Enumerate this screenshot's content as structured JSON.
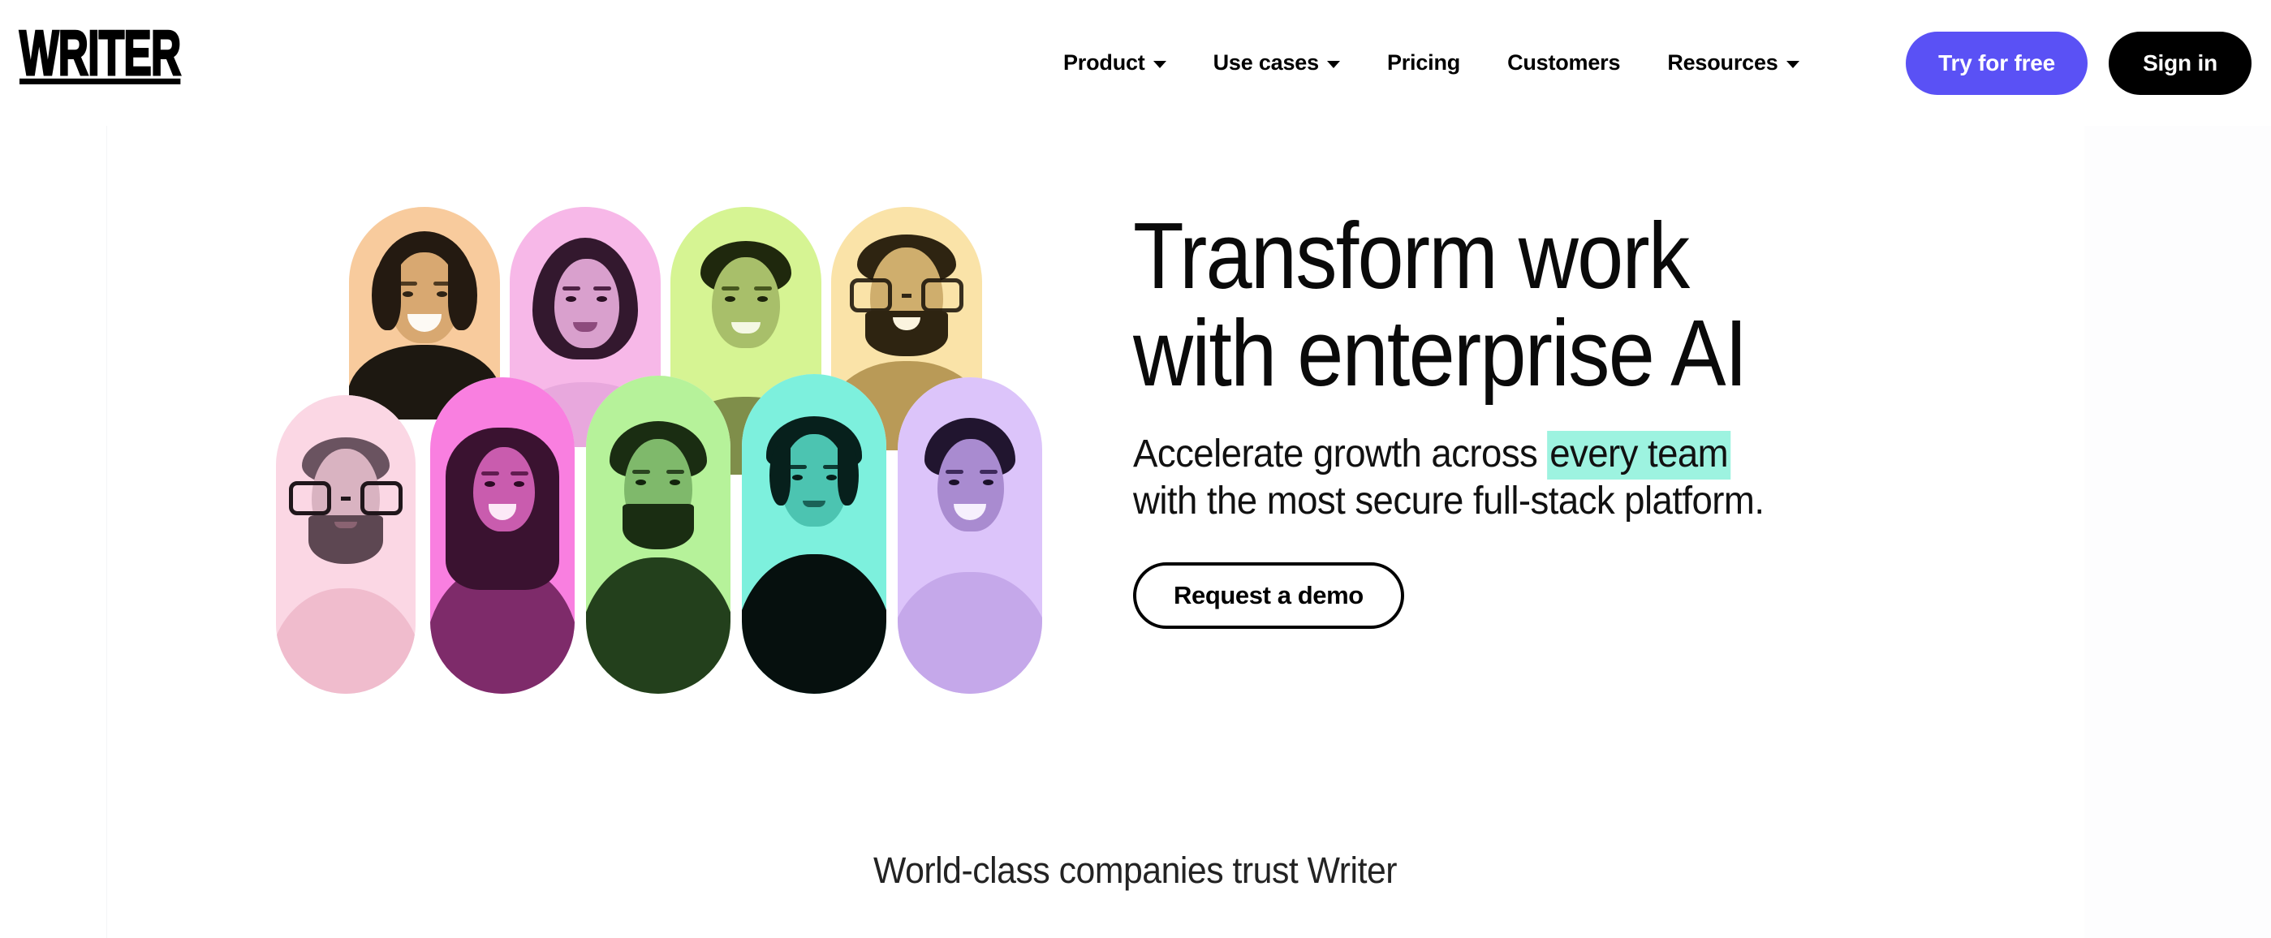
{
  "brand": {
    "logo_text": "WRITER"
  },
  "nav": {
    "links": [
      {
        "label": "Product",
        "has_dropdown": true,
        "icon": "chevron-down-icon"
      },
      {
        "label": "Use cases",
        "has_dropdown": true,
        "icon": "chevron-down-icon"
      },
      {
        "label": "Pricing",
        "has_dropdown": false,
        "icon": ""
      },
      {
        "label": "Customers",
        "has_dropdown": false,
        "icon": ""
      },
      {
        "label": "Resources",
        "has_dropdown": true,
        "icon": "chevron-down-icon"
      }
    ],
    "try_label": "Try for free",
    "signin_label": "Sign in",
    "try_color": "#5a51f5",
    "signin_color": "#000000"
  },
  "hero": {
    "headline": "Transform work\nwith enterprise AI",
    "subhead_before": "Accelerate growth across ",
    "subhead_highlight": "every team",
    "subhead_after": "\nwith the most secure full-stack platform.",
    "subhead_line1_before": "Accelerate growth across ",
    "subhead_line1_highlight": "every team",
    "subhead_line2": "with the most secure full-stack platform.",
    "highlight_color": "#9df3e0",
    "cta_label": "Request a demo"
  },
  "collage": {
    "top_row": [
      {
        "name": "portrait-peach",
        "bg": "#f8cb9d",
        "tone": "#6b5230",
        "hair": "#231a10",
        "skin": "#d8a871"
      },
      {
        "name": "portrait-pink",
        "bg": "#f7b8e8",
        "tone": "#6d4268",
        "hair": "#2c1a2a",
        "skin": "#d9a0cd"
      },
      {
        "name": "portrait-lime",
        "bg": "#d6f493",
        "tone": "#5b6a2c",
        "hair": "#22280f",
        "skin": "#a8bf6a"
      },
      {
        "name": "portrait-cream",
        "bg": "#fae3a8",
        "tone": "#7a6332",
        "hair": "#2e2411",
        "skin": "#cfae6d"
      }
    ],
    "bottom_row": [
      {
        "name": "portrait-blush",
        "bg": "#fbd7e4",
        "tone": "#7d5e6c",
        "hair": "#3c2c34",
        "skin": "#d9b3c1"
      },
      {
        "name": "portrait-magenta",
        "bg": "#f97fe0",
        "tone": "#7a2a68",
        "hair": "#35102c",
        "skin": "#c95cae"
      },
      {
        "name": "portrait-mint",
        "bg": "#b6f29a",
        "tone": "#2f5427",
        "hair": "#16290f",
        "skin": "#7fb96b"
      },
      {
        "name": "portrait-aqua",
        "bg": "#7df0dd",
        "tone": "#16564c",
        "hair": "#07201c",
        "skin": "#4cc4b1"
      },
      {
        "name": "portrait-lilac",
        "bg": "#dcc4fa",
        "tone": "#4e3670",
        "hair": "#1f1430",
        "skin": "#a98bd0"
      }
    ]
  },
  "trust": {
    "text": "World-class companies trust Writer"
  }
}
